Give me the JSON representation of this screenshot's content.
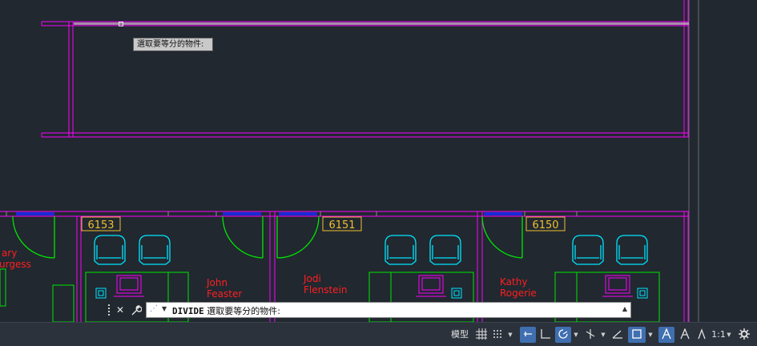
{
  "drawing": {
    "rooms": [
      {
        "number": "6153"
      },
      {
        "number": "6151"
      },
      {
        "number": "6150"
      }
    ],
    "occupants": [
      {
        "first": "ary",
        "last": "urgess"
      },
      {
        "first": "John",
        "last": "Feaster"
      },
      {
        "first": "Jodi",
        "last": "Flenstein"
      },
      {
        "first": "Kathy",
        "last": "Rogerie"
      }
    ],
    "tooltip": "選取要等分的物件:"
  },
  "command_line": {
    "command": "DIVIDE",
    "prompt": "選取要等分的物件:",
    "close_icon": "close-icon",
    "customize_icon": "wrench-icon"
  },
  "status_bar": {
    "model_label": "模型",
    "scale_label": "1:1",
    "active_color": "#3f6fb0"
  },
  "colors": {
    "background": "#212830",
    "walls": "#ff00ff",
    "furniture": "#00e5ff",
    "desks": "#00ff00",
    "names": "#ff1f1f",
    "room_numbers": "#f0c030",
    "windows": "#1a2bd6"
  }
}
